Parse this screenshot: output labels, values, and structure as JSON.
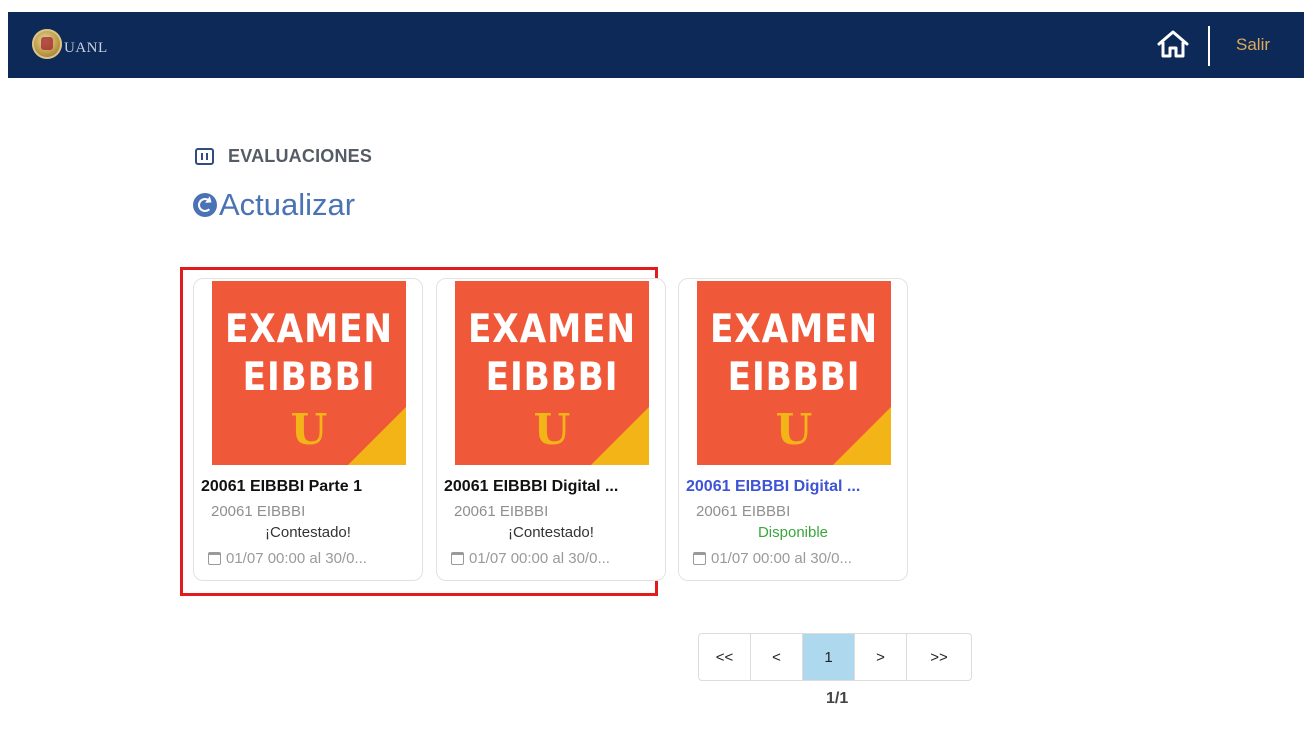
{
  "header": {
    "logo_text": "UANL",
    "exit_label": "Salir",
    "home_icon": "home-icon"
  },
  "section": {
    "title": "EVALUACIONES",
    "icon": "evaluations-icon",
    "refresh_label": "Actualizar"
  },
  "thumbnail": {
    "line1": "EXAMEN",
    "line2": "EIBBBI",
    "mark": "U"
  },
  "cards": [
    {
      "title": "20061 EIBBBI Parte 1",
      "subtitle": "20061 EIBBBI",
      "status": "¡Contestado!",
      "dates": "01/07 00:00 al 30/0..."
    },
    {
      "title": "20061 EIBBBI Digital ...",
      "subtitle": "20061 EIBBBI",
      "status": "¡Contestado!",
      "dates": "01/07 00:00 al 30/0..."
    },
    {
      "title": "20061 EIBBBI Digital ...",
      "subtitle": "20061 EIBBBI",
      "status": "Disponible",
      "dates": "01/07 00:00 al 30/0..."
    }
  ],
  "pagination": {
    "first": "<<",
    "prev": "<",
    "current": "1",
    "next": ">",
    "last": ">>",
    "summary": "1/1"
  },
  "colors": {
    "header_bg": "#0c2957",
    "exit_text": "#e0a85a",
    "accent_link": "#4a73b5",
    "thumb_bg": "#f0583a",
    "thumb_accent": "#f3b418",
    "status_available": "#3aa63f",
    "highlight_border": "#e01c1c",
    "active_page": "#aed8ee"
  }
}
